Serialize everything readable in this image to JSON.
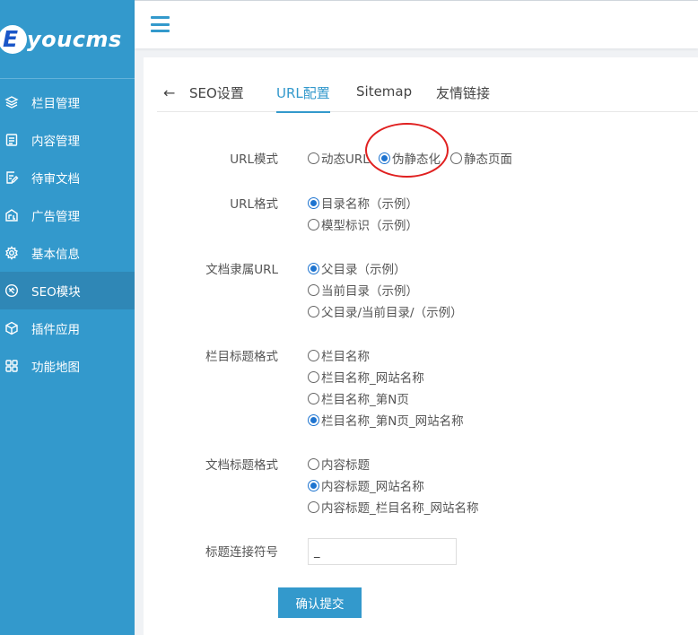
{
  "sidebar": {
    "logo_letter": "E",
    "logo_text": "youcms",
    "items": [
      {
        "label": "栏目管理",
        "icon": "layers-icon"
      },
      {
        "label": "内容管理",
        "icon": "document-list-icon"
      },
      {
        "label": "待审文档",
        "icon": "edit-document-icon"
      },
      {
        "label": "广告管理",
        "icon": "ad-icon"
      },
      {
        "label": "基本信息",
        "icon": "gear-icon"
      },
      {
        "label": "SEO模块",
        "icon": "seo-tag-icon",
        "active": true
      },
      {
        "label": "插件应用",
        "icon": "cube-icon"
      },
      {
        "label": "功能地图",
        "icon": "grid-icon"
      }
    ]
  },
  "tabs": {
    "back_icon": "←",
    "items": [
      {
        "label": "SEO设置"
      },
      {
        "label": "URL配置",
        "active": true
      },
      {
        "label": "Sitemap"
      },
      {
        "label": "友情链接"
      }
    ]
  },
  "form": {
    "url_mode": {
      "label": "URL模式",
      "options": [
        "动态URL",
        "伪静态化",
        "静态页面"
      ],
      "selected": "伪静态化"
    },
    "url_format": {
      "label": "URL格式",
      "options": [
        "目录名称（示例）",
        "模型标识（示例）"
      ],
      "selected": "目录名称（示例）"
    },
    "doc_url": {
      "label": "文档隶属URL",
      "options": [
        "父目录（示例）",
        "当前目录（示例）",
        "父目录/当前目录/（示例）"
      ],
      "selected": "父目录（示例）"
    },
    "column_title": {
      "label": "栏目标题格式",
      "options": [
        "栏目名称",
        "栏目名称_网站名称",
        "栏目名称_第N页",
        "栏目名称_第N页_网站名称"
      ],
      "selected": "栏目名称_第N页_网站名称"
    },
    "doc_title": {
      "label": "文档标题格式",
      "options": [
        "内容标题",
        "内容标题_网站名称",
        "内容标题_栏目名称_网站名称"
      ],
      "selected": "内容标题_网站名称"
    },
    "separator": {
      "label": "标题连接符号",
      "value": "_"
    },
    "submit_label": "确认提交"
  },
  "colors": {
    "accent": "#3399cc",
    "annotation": "#e02020"
  }
}
